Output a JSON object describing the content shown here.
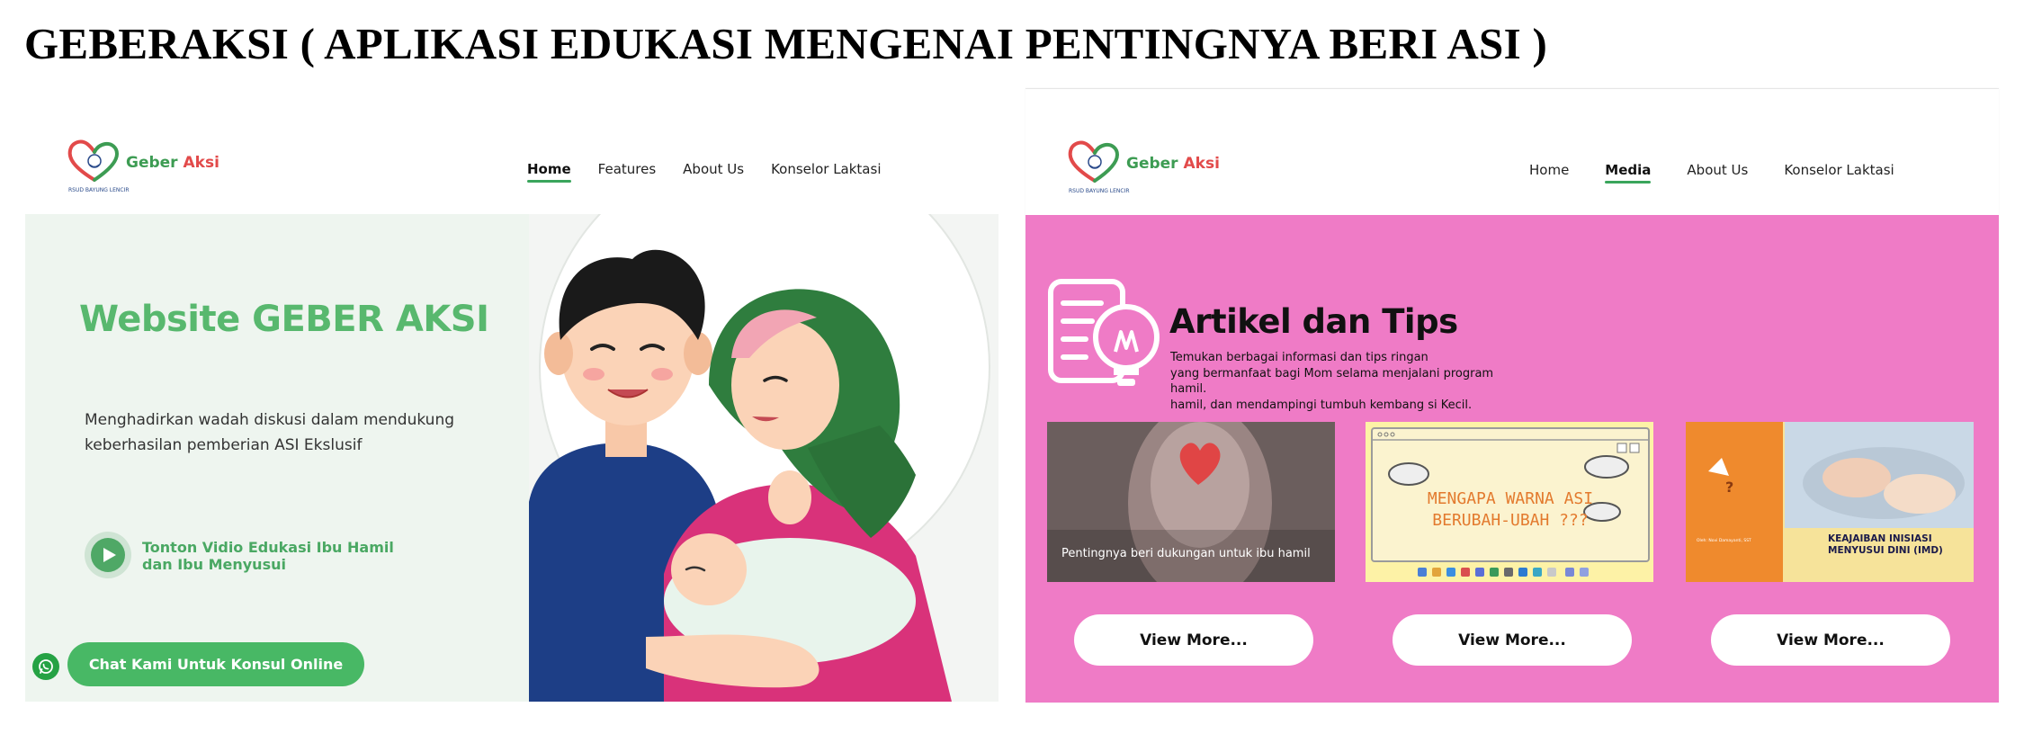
{
  "page": {
    "title": "GEBERAKSI ( APLIKASI EDUKASI MENGENAI PENTINGNYA BERI ASI )"
  },
  "logo": {
    "text_green": "Geber",
    "text_red": "Aksi",
    "subtitle": "RSUD BAYUNG LENCIR"
  },
  "left_screen": {
    "nav": [
      {
        "label": "Home",
        "active": true
      },
      {
        "label": "Features",
        "active": false
      },
      {
        "label": "About Us",
        "active": false
      },
      {
        "label": "Konselor Laktasi",
        "active": false
      }
    ],
    "heading": "Website GEBER AKSI",
    "description": "Menghadirkan wadah diskusi dalam mendukung keberhasilan pemberian ASI Ekslusif",
    "video_label": "Tonton Vidio Edukasi Ibu Hamil dan Ibu Menyusui",
    "chat_button": "Chat Kami Untuk Konsul Online"
  },
  "right_screen": {
    "nav": [
      {
        "label": "Home",
        "active": false
      },
      {
        "label": "Media",
        "active": true
      },
      {
        "label": "About Us",
        "active": false
      },
      {
        "label": "Konselor Laktasi",
        "active": false
      }
    ],
    "section_title": "Artikel dan Tips",
    "section_desc": "Temukan berbagai informasi dan tips ringan\nyang bermanfaat bagi Mom selama menjalani program hamil.\n hamil, dan mendampingi tumbuh kembang si Kecil.",
    "cards": [
      {
        "caption": "Pentingnya beri dukungan untuk ibu hamil",
        "button": "View More..."
      },
      {
        "caption": "MENGAPA WARNA ASI\nBERUBAH-UBAH ???",
        "button": "View More..."
      },
      {
        "caption": "KEAJAIBAN INISIASI\nMENYUSUI DINI (IMD)",
        "author": "Oleh: Novi Damayanti, SST",
        "button": "View More..."
      }
    ]
  },
  "colors": {
    "brand_green": "#58b86e",
    "media_pink": "#ef7bc6",
    "hero_bg": "#eef5ef"
  }
}
